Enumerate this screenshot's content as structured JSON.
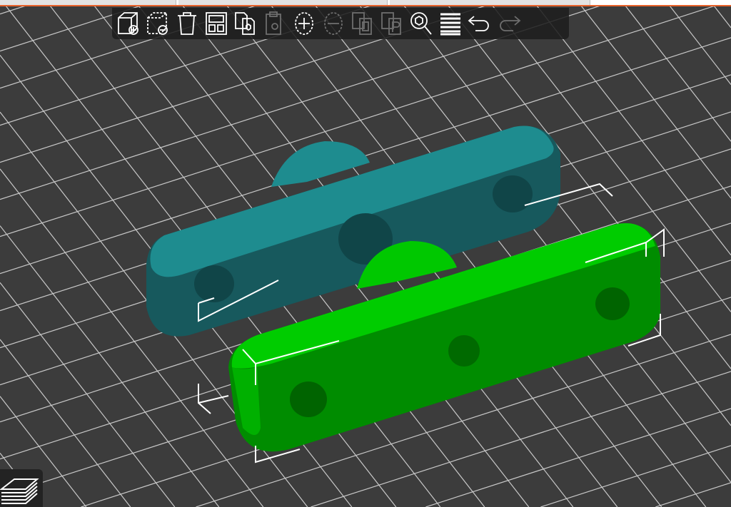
{
  "window": {
    "tabs": [
      "",
      "",
      " "
    ]
  },
  "toolbar": {
    "tools": [
      {
        "name": "add-object",
        "icon": "cube-plus-icon",
        "enabled": true
      },
      {
        "name": "delete-object",
        "icon": "cube-minus-icon",
        "enabled": true
      },
      {
        "name": "delete-all",
        "icon": "trash-icon",
        "enabled": true
      },
      {
        "name": "arrange",
        "icon": "arrange-icon",
        "enabled": true
      },
      {
        "name": "copy",
        "icon": "copy-icon",
        "enabled": true
      },
      {
        "name": "paste",
        "icon": "paste-icon",
        "enabled": false
      },
      {
        "name": "add-instance",
        "icon": "plus-circle-icon",
        "enabled": true
      },
      {
        "name": "remove-instance",
        "icon": "minus-circle-icon",
        "enabled": false
      },
      {
        "name": "split-objects",
        "icon": "split-objects-icon",
        "enabled": false
      },
      {
        "name": "split-parts",
        "icon": "split-parts-icon",
        "enabled": false
      },
      {
        "name": "search",
        "icon": "search-icon",
        "enabled": true
      },
      {
        "name": "layers-editing",
        "icon": "layers-icon",
        "enabled": true
      },
      {
        "name": "undo",
        "icon": "undo-icon",
        "enabled": true
      },
      {
        "name": "redo",
        "icon": "redo-icon",
        "enabled": false
      }
    ]
  },
  "scene": {
    "background": "#3c3c3c",
    "grid_color": "#c8c8c8",
    "objects": [
      {
        "name": "object-1",
        "color": "#1e8c8f",
        "selected": false
      },
      {
        "name": "object-2",
        "color": "#00c800",
        "selected": true
      }
    ]
  }
}
